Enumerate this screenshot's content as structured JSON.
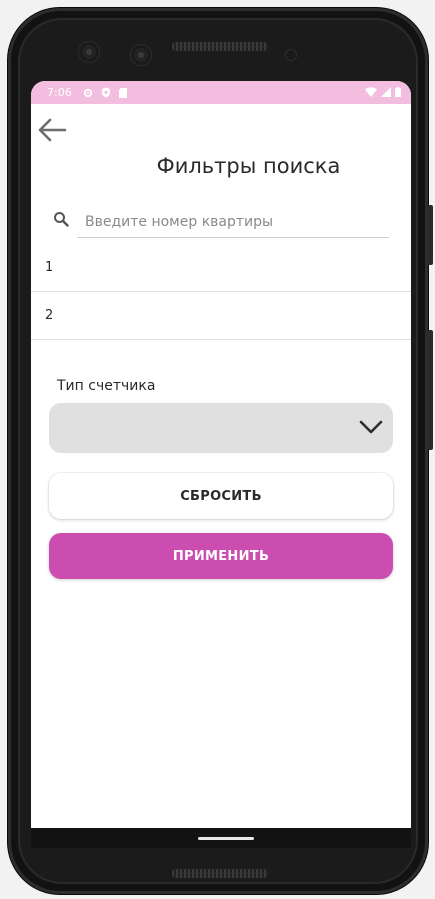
{
  "status_bar": {
    "time": "7:06",
    "left_icons": [
      "gear-icon",
      "shield-icon",
      "sd-card-icon"
    ],
    "right_icons": [
      "wifi-icon",
      "signal-icon",
      "battery-icon"
    ]
  },
  "header": {
    "back_icon": "arrow-left-icon",
    "title": "Фильтры поиска"
  },
  "search": {
    "icon": "search-icon",
    "placeholder": "Введите номер квартиры",
    "value": ""
  },
  "apartment_list": {
    "items": [
      "1",
      "2"
    ]
  },
  "meter_type": {
    "label": "Тип счетчика",
    "selected": "",
    "icon": "chevron-down-icon"
  },
  "actions": {
    "reset_label": "СБРОСИТЬ",
    "apply_label": "ПРИМЕНИТЬ"
  },
  "colors": {
    "status_bar": "#f3bde0",
    "accent": "#cc4db0",
    "select_bg": "#e0e0e0"
  }
}
